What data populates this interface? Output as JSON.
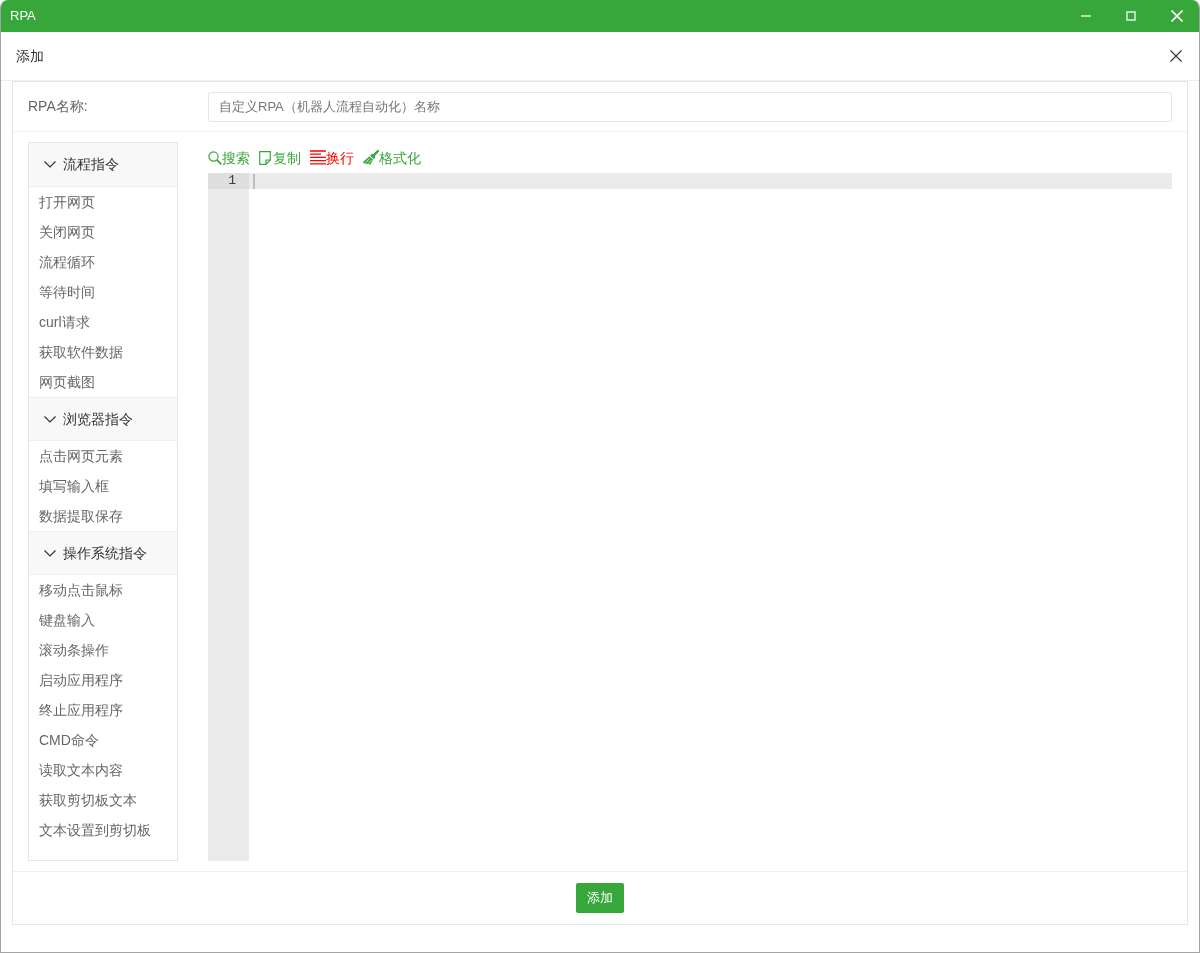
{
  "window": {
    "title": "RPA"
  },
  "dialog": {
    "title": "添加"
  },
  "form": {
    "label": "RPA名称:",
    "name_input": {
      "placeholder": "自定义RPA（机器人流程自动化）名称"
    }
  },
  "sidebar": {
    "groups": [
      {
        "title": "流程指令",
        "expanded": true,
        "items": [
          "打开网页",
          "关闭网页",
          "流程循环",
          "等待时间",
          "curl请求",
          "获取软件数据",
          "网页截图"
        ]
      },
      {
        "title": "浏览器指令",
        "expanded": true,
        "items": [
          "点击网页元素",
          "填写输入框",
          "数据提取保存"
        ]
      },
      {
        "title": "操作系统指令",
        "expanded": true,
        "items": [
          "移动点击鼠标",
          "键盘输入",
          "滚动条操作",
          "启动应用程序",
          "终止应用程序",
          "CMD命令",
          "读取文本内容",
          "获取剪切板文本",
          "文本设置到剪切板"
        ]
      }
    ]
  },
  "editor": {
    "toolbar": [
      {
        "kind": "search",
        "label": "搜索",
        "color": "#3aa63c"
      },
      {
        "kind": "copy",
        "label": "复制",
        "color": "#3aa63c"
      },
      {
        "kind": "wrap",
        "label": "换行",
        "color": "#ff0000"
      },
      {
        "kind": "format",
        "label": "格式化",
        "color": "#3aa63c"
      }
    ],
    "lines": [
      {
        "number": "1",
        "active": true
      }
    ]
  },
  "footer": {
    "submit": "添加"
  }
}
